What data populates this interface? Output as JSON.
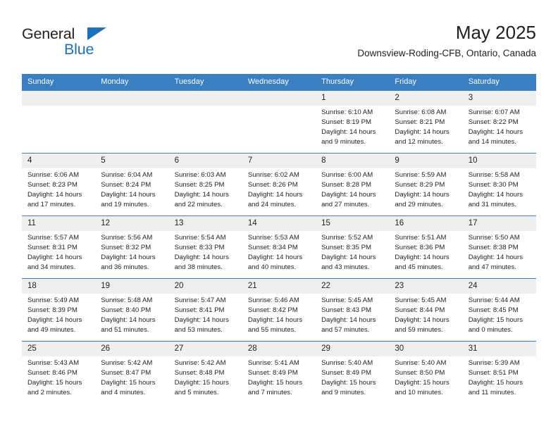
{
  "brand": {
    "name_top": "General",
    "name_bottom": "Blue",
    "accent_color": "#1b72b8"
  },
  "header": {
    "title": "May 2025",
    "subtitle": "Downsview-Roding-CFB, Ontario, Canada"
  },
  "theme": {
    "header_row_bg": "#3a7fc1",
    "daynum_bg": "#efefef",
    "text_color": "#231f20"
  },
  "weekday_headers": [
    "Sunday",
    "Monday",
    "Tuesday",
    "Wednesday",
    "Thursday",
    "Friday",
    "Saturday"
  ],
  "weeks": [
    [
      {
        "day": "",
        "sunrise": "",
        "sunset": "",
        "daylight_line1": "",
        "daylight_line2": ""
      },
      {
        "day": "",
        "sunrise": "",
        "sunset": "",
        "daylight_line1": "",
        "daylight_line2": ""
      },
      {
        "day": "",
        "sunrise": "",
        "sunset": "",
        "daylight_line1": "",
        "daylight_line2": ""
      },
      {
        "day": "",
        "sunrise": "",
        "sunset": "",
        "daylight_line1": "",
        "daylight_line2": ""
      },
      {
        "day": "1",
        "sunrise": "Sunrise: 6:10 AM",
        "sunset": "Sunset: 8:19 PM",
        "daylight_line1": "Daylight: 14 hours",
        "daylight_line2": "and 9 minutes."
      },
      {
        "day": "2",
        "sunrise": "Sunrise: 6:08 AM",
        "sunset": "Sunset: 8:21 PM",
        "daylight_line1": "Daylight: 14 hours",
        "daylight_line2": "and 12 minutes."
      },
      {
        "day": "3",
        "sunrise": "Sunrise: 6:07 AM",
        "sunset": "Sunset: 8:22 PM",
        "daylight_line1": "Daylight: 14 hours",
        "daylight_line2": "and 14 minutes."
      }
    ],
    [
      {
        "day": "4",
        "sunrise": "Sunrise: 6:06 AM",
        "sunset": "Sunset: 8:23 PM",
        "daylight_line1": "Daylight: 14 hours",
        "daylight_line2": "and 17 minutes."
      },
      {
        "day": "5",
        "sunrise": "Sunrise: 6:04 AM",
        "sunset": "Sunset: 8:24 PM",
        "daylight_line1": "Daylight: 14 hours",
        "daylight_line2": "and 19 minutes."
      },
      {
        "day": "6",
        "sunrise": "Sunrise: 6:03 AM",
        "sunset": "Sunset: 8:25 PM",
        "daylight_line1": "Daylight: 14 hours",
        "daylight_line2": "and 22 minutes."
      },
      {
        "day": "7",
        "sunrise": "Sunrise: 6:02 AM",
        "sunset": "Sunset: 8:26 PM",
        "daylight_line1": "Daylight: 14 hours",
        "daylight_line2": "and 24 minutes."
      },
      {
        "day": "8",
        "sunrise": "Sunrise: 6:00 AM",
        "sunset": "Sunset: 8:28 PM",
        "daylight_line1": "Daylight: 14 hours",
        "daylight_line2": "and 27 minutes."
      },
      {
        "day": "9",
        "sunrise": "Sunrise: 5:59 AM",
        "sunset": "Sunset: 8:29 PM",
        "daylight_line1": "Daylight: 14 hours",
        "daylight_line2": "and 29 minutes."
      },
      {
        "day": "10",
        "sunrise": "Sunrise: 5:58 AM",
        "sunset": "Sunset: 8:30 PM",
        "daylight_line1": "Daylight: 14 hours",
        "daylight_line2": "and 31 minutes."
      }
    ],
    [
      {
        "day": "11",
        "sunrise": "Sunrise: 5:57 AM",
        "sunset": "Sunset: 8:31 PM",
        "daylight_line1": "Daylight: 14 hours",
        "daylight_line2": "and 34 minutes."
      },
      {
        "day": "12",
        "sunrise": "Sunrise: 5:56 AM",
        "sunset": "Sunset: 8:32 PM",
        "daylight_line1": "Daylight: 14 hours",
        "daylight_line2": "and 36 minutes."
      },
      {
        "day": "13",
        "sunrise": "Sunrise: 5:54 AM",
        "sunset": "Sunset: 8:33 PM",
        "daylight_line1": "Daylight: 14 hours",
        "daylight_line2": "and 38 minutes."
      },
      {
        "day": "14",
        "sunrise": "Sunrise: 5:53 AM",
        "sunset": "Sunset: 8:34 PM",
        "daylight_line1": "Daylight: 14 hours",
        "daylight_line2": "and 40 minutes."
      },
      {
        "day": "15",
        "sunrise": "Sunrise: 5:52 AM",
        "sunset": "Sunset: 8:35 PM",
        "daylight_line1": "Daylight: 14 hours",
        "daylight_line2": "and 43 minutes."
      },
      {
        "day": "16",
        "sunrise": "Sunrise: 5:51 AM",
        "sunset": "Sunset: 8:36 PM",
        "daylight_line1": "Daylight: 14 hours",
        "daylight_line2": "and 45 minutes."
      },
      {
        "day": "17",
        "sunrise": "Sunrise: 5:50 AM",
        "sunset": "Sunset: 8:38 PM",
        "daylight_line1": "Daylight: 14 hours",
        "daylight_line2": "and 47 minutes."
      }
    ],
    [
      {
        "day": "18",
        "sunrise": "Sunrise: 5:49 AM",
        "sunset": "Sunset: 8:39 PM",
        "daylight_line1": "Daylight: 14 hours",
        "daylight_line2": "and 49 minutes."
      },
      {
        "day": "19",
        "sunrise": "Sunrise: 5:48 AM",
        "sunset": "Sunset: 8:40 PM",
        "daylight_line1": "Daylight: 14 hours",
        "daylight_line2": "and 51 minutes."
      },
      {
        "day": "20",
        "sunrise": "Sunrise: 5:47 AM",
        "sunset": "Sunset: 8:41 PM",
        "daylight_line1": "Daylight: 14 hours",
        "daylight_line2": "and 53 minutes."
      },
      {
        "day": "21",
        "sunrise": "Sunrise: 5:46 AM",
        "sunset": "Sunset: 8:42 PM",
        "daylight_line1": "Daylight: 14 hours",
        "daylight_line2": "and 55 minutes."
      },
      {
        "day": "22",
        "sunrise": "Sunrise: 5:45 AM",
        "sunset": "Sunset: 8:43 PM",
        "daylight_line1": "Daylight: 14 hours",
        "daylight_line2": "and 57 minutes."
      },
      {
        "day": "23",
        "sunrise": "Sunrise: 5:45 AM",
        "sunset": "Sunset: 8:44 PM",
        "daylight_line1": "Daylight: 14 hours",
        "daylight_line2": "and 59 minutes."
      },
      {
        "day": "24",
        "sunrise": "Sunrise: 5:44 AM",
        "sunset": "Sunset: 8:45 PM",
        "daylight_line1": "Daylight: 15 hours",
        "daylight_line2": "and 0 minutes."
      }
    ],
    [
      {
        "day": "25",
        "sunrise": "Sunrise: 5:43 AM",
        "sunset": "Sunset: 8:46 PM",
        "daylight_line1": "Daylight: 15 hours",
        "daylight_line2": "and 2 minutes."
      },
      {
        "day": "26",
        "sunrise": "Sunrise: 5:42 AM",
        "sunset": "Sunset: 8:47 PM",
        "daylight_line1": "Daylight: 15 hours",
        "daylight_line2": "and 4 minutes."
      },
      {
        "day": "27",
        "sunrise": "Sunrise: 5:42 AM",
        "sunset": "Sunset: 8:48 PM",
        "daylight_line1": "Daylight: 15 hours",
        "daylight_line2": "and 5 minutes."
      },
      {
        "day": "28",
        "sunrise": "Sunrise: 5:41 AM",
        "sunset": "Sunset: 8:49 PM",
        "daylight_line1": "Daylight: 15 hours",
        "daylight_line2": "and 7 minutes."
      },
      {
        "day": "29",
        "sunrise": "Sunrise: 5:40 AM",
        "sunset": "Sunset: 8:49 PM",
        "daylight_line1": "Daylight: 15 hours",
        "daylight_line2": "and 9 minutes."
      },
      {
        "day": "30",
        "sunrise": "Sunrise: 5:40 AM",
        "sunset": "Sunset: 8:50 PM",
        "daylight_line1": "Daylight: 15 hours",
        "daylight_line2": "and 10 minutes."
      },
      {
        "day": "31",
        "sunrise": "Sunrise: 5:39 AM",
        "sunset": "Sunset: 8:51 PM",
        "daylight_line1": "Daylight: 15 hours",
        "daylight_line2": "and 11 minutes."
      }
    ]
  ]
}
